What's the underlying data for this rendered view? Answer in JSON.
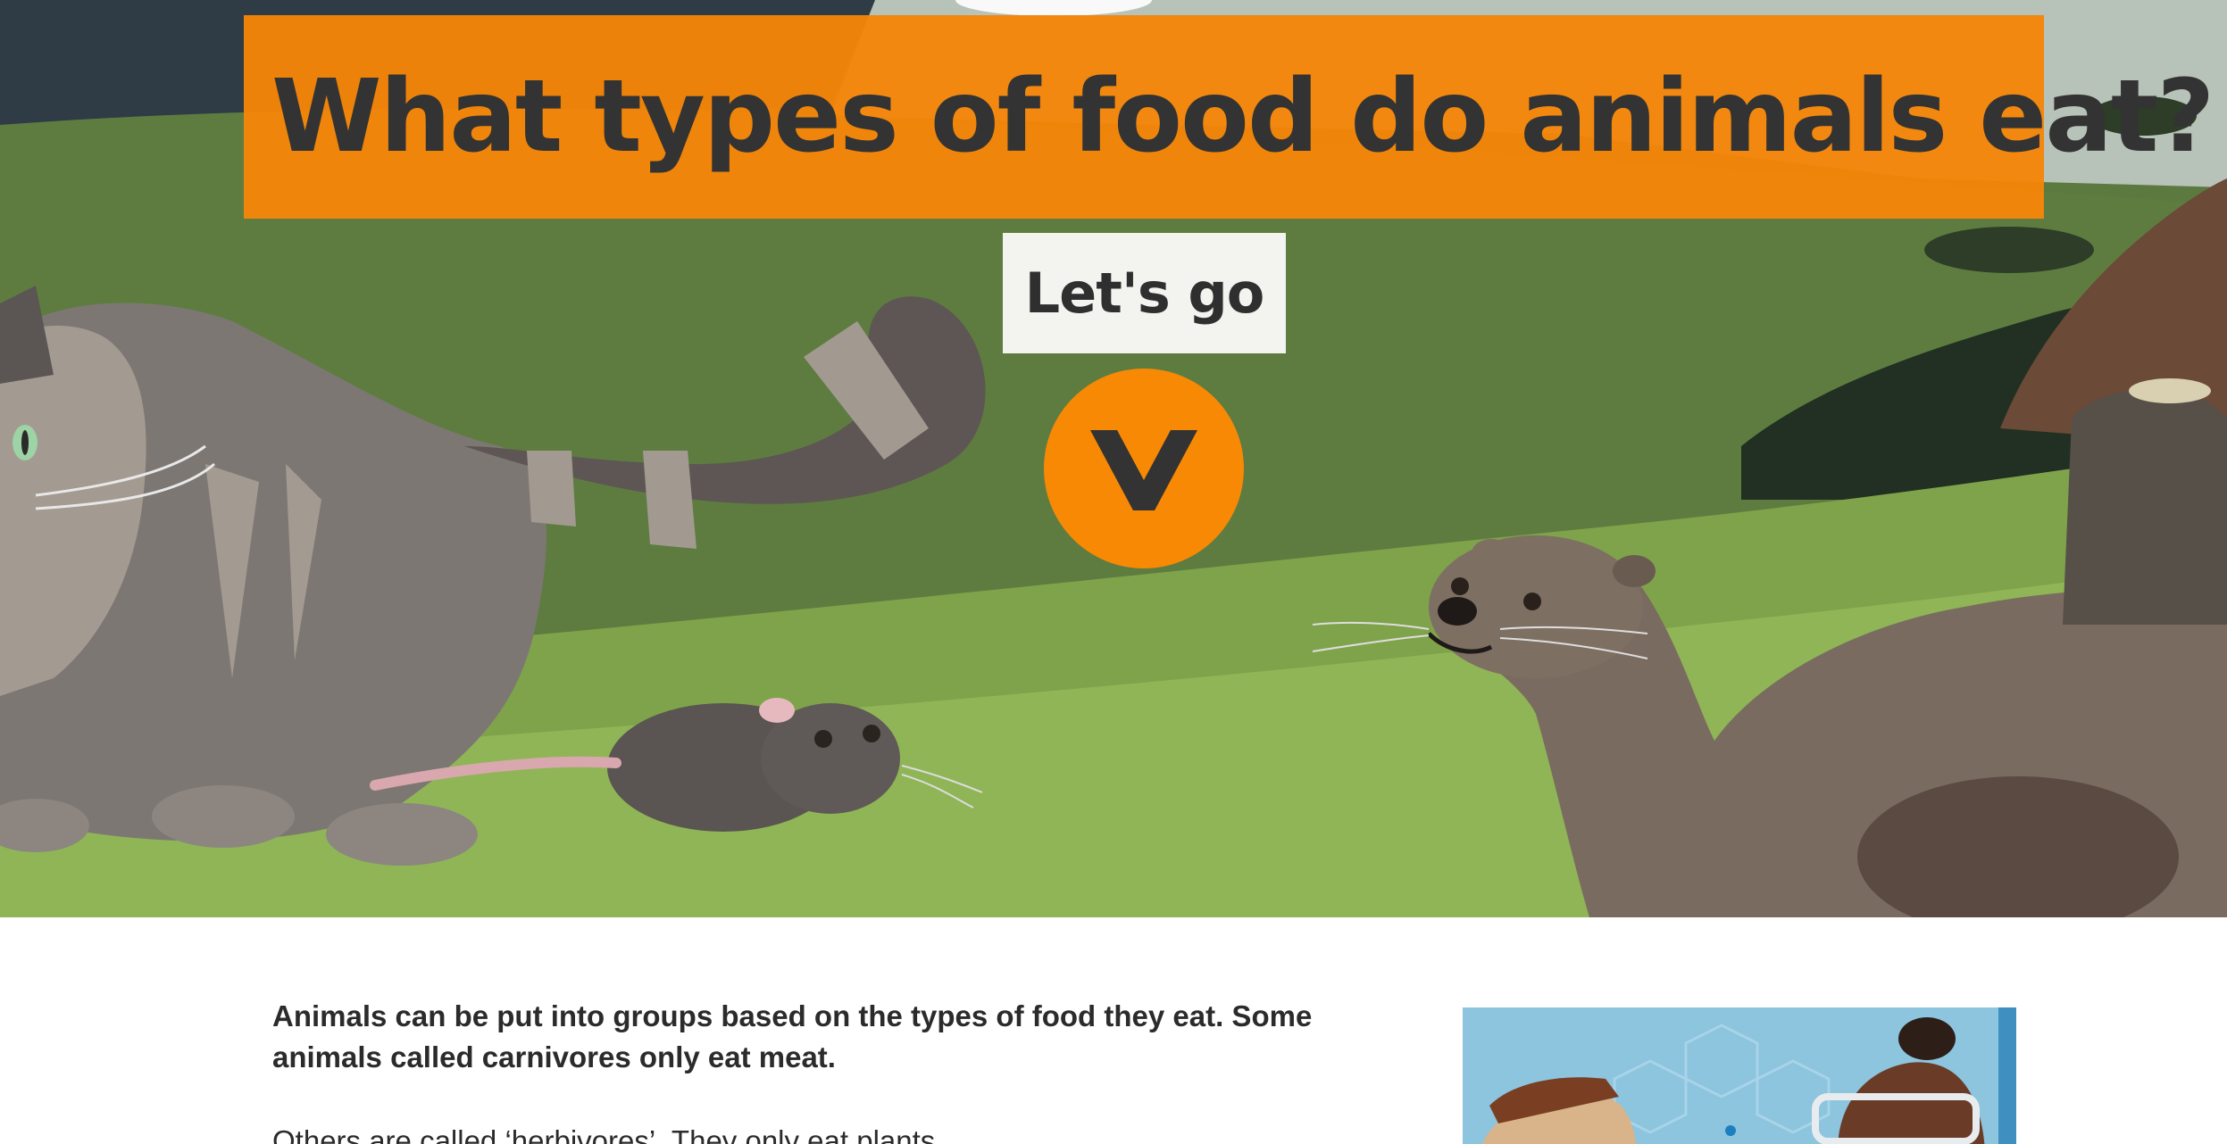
{
  "hero": {
    "title": "What types of food do animals eat?",
    "cta_label": "Let's go",
    "scroll_icon": "chevron-down-icon"
  },
  "article": {
    "intro_bold": "Animals can be put into groups based on the types of food they eat. Some animals called carnivores only eat meat.",
    "intro_text": "Others are called ‘herbivores’. They only eat plants."
  },
  "colors": {
    "accent": "#f5850a",
    "button_bg": "#f3f3f0",
    "text": "#333333"
  }
}
